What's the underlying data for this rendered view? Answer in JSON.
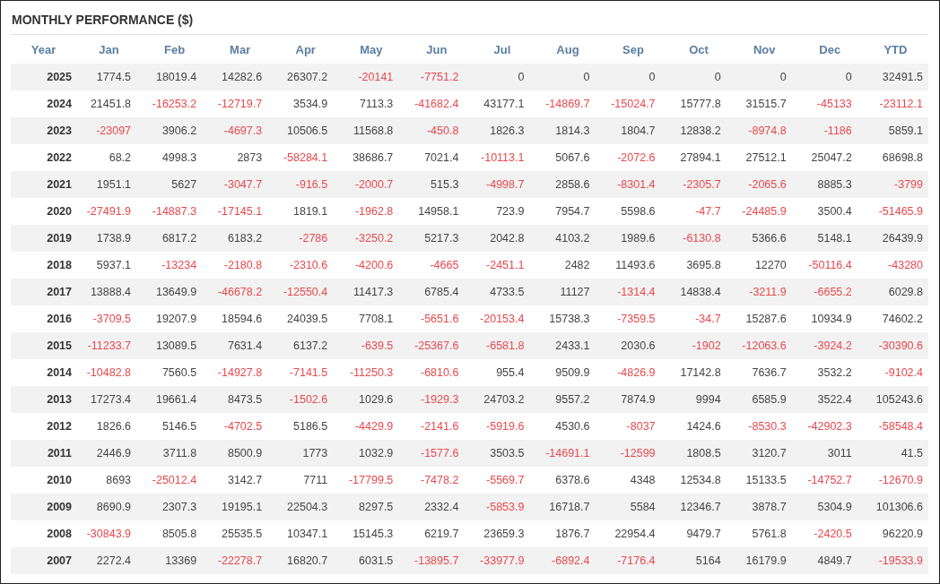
{
  "title": "MONTHLY PERFORMANCE ($)",
  "columns": [
    "Year",
    "Jan",
    "Feb",
    "Mar",
    "Apr",
    "May",
    "Jun",
    "Jul",
    "Aug",
    "Sep",
    "Oct",
    "Nov",
    "Dec",
    "YTD"
  ],
  "rows": [
    {
      "year": "2025",
      "cells": [
        {
          "value": "1774.5",
          "negative": false
        },
        {
          "value": "18019.4",
          "negative": false
        },
        {
          "value": "14282.6",
          "negative": false
        },
        {
          "value": "26307.2",
          "negative": false
        },
        {
          "value": "-20141",
          "negative": true
        },
        {
          "value": "-7751.2",
          "negative": true
        },
        {
          "value": "0",
          "negative": false
        },
        {
          "value": "0",
          "negative": false
        },
        {
          "value": "0",
          "negative": false
        },
        {
          "value": "0",
          "negative": false
        },
        {
          "value": "0",
          "negative": false
        },
        {
          "value": "0",
          "negative": false
        },
        {
          "value": "32491.5",
          "negative": false
        }
      ]
    },
    {
      "year": "2024",
      "cells": [
        {
          "value": "21451.8",
          "negative": false
        },
        {
          "value": "-16253.2",
          "negative": true
        },
        {
          "value": "-12719.7",
          "negative": true
        },
        {
          "value": "3534.9",
          "negative": false
        },
        {
          "value": "7113.3",
          "negative": false
        },
        {
          "value": "-41682.4",
          "negative": true
        },
        {
          "value": "43177.1",
          "negative": false
        },
        {
          "value": "-14869.7",
          "negative": true
        },
        {
          "value": "-15024.7",
          "negative": true
        },
        {
          "value": "15777.8",
          "negative": false
        },
        {
          "value": "31515.7",
          "negative": false
        },
        {
          "value": "-45133",
          "negative": true
        },
        {
          "value": "-23112.1",
          "negative": true
        }
      ]
    },
    {
      "year": "2023",
      "cells": [
        {
          "value": "-23097",
          "negative": true
        },
        {
          "value": "3906.2",
          "negative": false
        },
        {
          "value": "-4697.3",
          "negative": true
        },
        {
          "value": "10506.5",
          "negative": false
        },
        {
          "value": "11568.8",
          "negative": false
        },
        {
          "value": "-450.8",
          "negative": true
        },
        {
          "value": "1826.3",
          "negative": false
        },
        {
          "value": "1814.3",
          "negative": false
        },
        {
          "value": "1804.7",
          "negative": false
        },
        {
          "value": "12838.2",
          "negative": false
        },
        {
          "value": "-8974.8",
          "negative": true
        },
        {
          "value": "-1186",
          "negative": true
        },
        {
          "value": "5859.1",
          "negative": false
        }
      ]
    },
    {
      "year": "2022",
      "cells": [
        {
          "value": "68.2",
          "negative": false
        },
        {
          "value": "4998.3",
          "negative": false
        },
        {
          "value": "2873",
          "negative": false
        },
        {
          "value": "-58284.1",
          "negative": true
        },
        {
          "value": "38686.7",
          "negative": false
        },
        {
          "value": "7021.4",
          "negative": false
        },
        {
          "value": "-10113.1",
          "negative": true
        },
        {
          "value": "5067.6",
          "negative": false
        },
        {
          "value": "-2072.6",
          "negative": true
        },
        {
          "value": "27894.1",
          "negative": false
        },
        {
          "value": "27512.1",
          "negative": false
        },
        {
          "value": "25047.2",
          "negative": false
        },
        {
          "value": "68698.8",
          "negative": false
        }
      ]
    },
    {
      "year": "2021",
      "cells": [
        {
          "value": "1951.1",
          "negative": false
        },
        {
          "value": "5627",
          "negative": false
        },
        {
          "value": "-3047.7",
          "negative": true
        },
        {
          "value": "-916.5",
          "negative": true
        },
        {
          "value": "-2000.7",
          "negative": true
        },
        {
          "value": "515.3",
          "negative": false
        },
        {
          "value": "-4998.7",
          "negative": true
        },
        {
          "value": "2858.6",
          "negative": false
        },
        {
          "value": "-8301.4",
          "negative": true
        },
        {
          "value": "-2305.7",
          "negative": true
        },
        {
          "value": "-2065.6",
          "negative": true
        },
        {
          "value": "8885.3",
          "negative": false
        },
        {
          "value": "-3799",
          "negative": true
        }
      ]
    },
    {
      "year": "2020",
      "cells": [
        {
          "value": "-27491.9",
          "negative": true
        },
        {
          "value": "-14887.3",
          "negative": true
        },
        {
          "value": "-17145.1",
          "negative": true
        },
        {
          "value": "1819.1",
          "negative": false
        },
        {
          "value": "-1962.8",
          "negative": true
        },
        {
          "value": "14958.1",
          "negative": false
        },
        {
          "value": "723.9",
          "negative": false
        },
        {
          "value": "7954.7",
          "negative": false
        },
        {
          "value": "5598.6",
          "negative": false
        },
        {
          "value": "-47.7",
          "negative": true
        },
        {
          "value": "-24485.9",
          "negative": true
        },
        {
          "value": "3500.4",
          "negative": false
        },
        {
          "value": "-51465.9",
          "negative": true
        }
      ]
    },
    {
      "year": "2019",
      "cells": [
        {
          "value": "1738.9",
          "negative": false
        },
        {
          "value": "6817.2",
          "negative": false
        },
        {
          "value": "6183.2",
          "negative": false
        },
        {
          "value": "-2786",
          "negative": true
        },
        {
          "value": "-3250.2",
          "negative": true
        },
        {
          "value": "5217.3",
          "negative": false
        },
        {
          "value": "2042.8",
          "negative": false
        },
        {
          "value": "4103.2",
          "negative": false
        },
        {
          "value": "1989.6",
          "negative": false
        },
        {
          "value": "-6130.8",
          "negative": true
        },
        {
          "value": "5366.6",
          "negative": false
        },
        {
          "value": "5148.1",
          "negative": false
        },
        {
          "value": "26439.9",
          "negative": false
        }
      ]
    },
    {
      "year": "2018",
      "cells": [
        {
          "value": "5937.1",
          "negative": false
        },
        {
          "value": "-13234",
          "negative": true
        },
        {
          "value": "-2180.8",
          "negative": true
        },
        {
          "value": "-2310.6",
          "negative": true
        },
        {
          "value": "-4200.6",
          "negative": true
        },
        {
          "value": "-4665",
          "negative": true
        },
        {
          "value": "-2451.1",
          "negative": true
        },
        {
          "value": "2482",
          "negative": false
        },
        {
          "value": "11493.6",
          "negative": false
        },
        {
          "value": "3695.8",
          "negative": false
        },
        {
          "value": "12270",
          "negative": false
        },
        {
          "value": "-50116.4",
          "negative": true
        },
        {
          "value": "-43280",
          "negative": true
        }
      ]
    },
    {
      "year": "2017",
      "cells": [
        {
          "value": "13888.4",
          "negative": false
        },
        {
          "value": "13649.9",
          "negative": false
        },
        {
          "value": "-46678.2",
          "negative": true
        },
        {
          "value": "-12550.4",
          "negative": true
        },
        {
          "value": "11417.3",
          "negative": false
        },
        {
          "value": "6785.4",
          "negative": false
        },
        {
          "value": "4733.5",
          "negative": false
        },
        {
          "value": "11127",
          "negative": false
        },
        {
          "value": "-1314.4",
          "negative": true
        },
        {
          "value": "14838.4",
          "negative": false
        },
        {
          "value": "-3211.9",
          "negative": true
        },
        {
          "value": "-6655.2",
          "negative": true
        },
        {
          "value": "6029.8",
          "negative": false
        }
      ]
    },
    {
      "year": "2016",
      "cells": [
        {
          "value": "-3709.5",
          "negative": true
        },
        {
          "value": "19207.9",
          "negative": false
        },
        {
          "value": "18594.6",
          "negative": false
        },
        {
          "value": "24039.5",
          "negative": false
        },
        {
          "value": "7708.1",
          "negative": false
        },
        {
          "value": "-5651.6",
          "negative": true
        },
        {
          "value": "-20153.4",
          "negative": true
        },
        {
          "value": "15738.3",
          "negative": false
        },
        {
          "value": "-7359.5",
          "negative": true
        },
        {
          "value": "-34.7",
          "negative": true
        },
        {
          "value": "15287.6",
          "negative": false
        },
        {
          "value": "10934.9",
          "negative": false
        },
        {
          "value": "74602.2",
          "negative": false
        }
      ]
    },
    {
      "year": "2015",
      "cells": [
        {
          "value": "-11233.7",
          "negative": true
        },
        {
          "value": "13089.5",
          "negative": false
        },
        {
          "value": "7631.4",
          "negative": false
        },
        {
          "value": "6137.2",
          "negative": false
        },
        {
          "value": "-639.5",
          "negative": true
        },
        {
          "value": "-25367.6",
          "negative": true
        },
        {
          "value": "-6581.8",
          "negative": true
        },
        {
          "value": "2433.1",
          "negative": false
        },
        {
          "value": "2030.6",
          "negative": false
        },
        {
          "value": "-1902",
          "negative": true
        },
        {
          "value": "-12063.6",
          "negative": true
        },
        {
          "value": "-3924.2",
          "negative": true
        },
        {
          "value": "-30390.6",
          "negative": true
        }
      ]
    },
    {
      "year": "2014",
      "cells": [
        {
          "value": "-10482.8",
          "negative": true
        },
        {
          "value": "7560.5",
          "negative": false
        },
        {
          "value": "-14927.8",
          "negative": true
        },
        {
          "value": "-7141.5",
          "negative": true
        },
        {
          "value": "-11250.3",
          "negative": true
        },
        {
          "value": "-6810.6",
          "negative": true
        },
        {
          "value": "955.4",
          "negative": false
        },
        {
          "value": "9509.9",
          "negative": false
        },
        {
          "value": "-4826.9",
          "negative": true
        },
        {
          "value": "17142.8",
          "negative": false
        },
        {
          "value": "7636.7",
          "negative": false
        },
        {
          "value": "3532.2",
          "negative": false
        },
        {
          "value": "-9102.4",
          "negative": true
        }
      ]
    },
    {
      "year": "2013",
      "cells": [
        {
          "value": "17273.4",
          "negative": false
        },
        {
          "value": "19661.4",
          "negative": false
        },
        {
          "value": "8473.5",
          "negative": false
        },
        {
          "value": "-1502.6",
          "negative": true
        },
        {
          "value": "1029.6",
          "negative": false
        },
        {
          "value": "-1929.3",
          "negative": true
        },
        {
          "value": "24703.2",
          "negative": false
        },
        {
          "value": "9557.2",
          "negative": false
        },
        {
          "value": "7874.9",
          "negative": false
        },
        {
          "value": "9994",
          "negative": false
        },
        {
          "value": "6585.9",
          "negative": false
        },
        {
          "value": "3522.4",
          "negative": false
        },
        {
          "value": "105243.6",
          "negative": false
        }
      ]
    },
    {
      "year": "2012",
      "cells": [
        {
          "value": "1826.6",
          "negative": false
        },
        {
          "value": "5146.5",
          "negative": false
        },
        {
          "value": "-4702.5",
          "negative": true
        },
        {
          "value": "5186.5",
          "negative": false
        },
        {
          "value": "-4429.9",
          "negative": true
        },
        {
          "value": "-2141.6",
          "negative": true
        },
        {
          "value": "-5919.6",
          "negative": true
        },
        {
          "value": "4530.6",
          "negative": false
        },
        {
          "value": "-8037",
          "negative": true
        },
        {
          "value": "1424.6",
          "negative": false
        },
        {
          "value": "-8530.3",
          "negative": true
        },
        {
          "value": "-42902.3",
          "negative": true
        },
        {
          "value": "-58548.4",
          "negative": true
        }
      ]
    },
    {
      "year": "2011",
      "cells": [
        {
          "value": "2446.9",
          "negative": false
        },
        {
          "value": "3711.8",
          "negative": false
        },
        {
          "value": "8500.9",
          "negative": false
        },
        {
          "value": "1773",
          "negative": false
        },
        {
          "value": "1032.9",
          "negative": false
        },
        {
          "value": "-1577.6",
          "negative": true
        },
        {
          "value": "3503.5",
          "negative": false
        },
        {
          "value": "-14691.1",
          "negative": true
        },
        {
          "value": "-12599",
          "negative": true
        },
        {
          "value": "1808.5",
          "negative": false
        },
        {
          "value": "3120.7",
          "negative": false
        },
        {
          "value": "3011",
          "negative": false
        },
        {
          "value": "41.5",
          "negative": false
        }
      ]
    },
    {
      "year": "2010",
      "cells": [
        {
          "value": "8693",
          "negative": false
        },
        {
          "value": "-25012.4",
          "negative": true
        },
        {
          "value": "3142.7",
          "negative": false
        },
        {
          "value": "7711",
          "negative": false
        },
        {
          "value": "-17799.5",
          "negative": true
        },
        {
          "value": "-7478.2",
          "negative": true
        },
        {
          "value": "-5569.7",
          "negative": true
        },
        {
          "value": "6378.6",
          "negative": false
        },
        {
          "value": "4348",
          "negative": false
        },
        {
          "value": "12534.8",
          "negative": false
        },
        {
          "value": "15133.5",
          "negative": false
        },
        {
          "value": "-14752.7",
          "negative": true
        },
        {
          "value": "-12670.9",
          "negative": true
        }
      ]
    },
    {
      "year": "2009",
      "cells": [
        {
          "value": "8690.9",
          "negative": false
        },
        {
          "value": "2307.3",
          "negative": false
        },
        {
          "value": "19195.1",
          "negative": false
        },
        {
          "value": "22504.3",
          "negative": false
        },
        {
          "value": "8297.5",
          "negative": false
        },
        {
          "value": "2332.4",
          "negative": false
        },
        {
          "value": "-5853.9",
          "negative": true
        },
        {
          "value": "16718.7",
          "negative": false
        },
        {
          "value": "5584",
          "negative": false
        },
        {
          "value": "12346.7",
          "negative": false
        },
        {
          "value": "3878.7",
          "negative": false
        },
        {
          "value": "5304.9",
          "negative": false
        },
        {
          "value": "101306.6",
          "negative": false
        }
      ]
    },
    {
      "year": "2008",
      "cells": [
        {
          "value": "-30843.9",
          "negative": true
        },
        {
          "value": "8505.8",
          "negative": false
        },
        {
          "value": "25535.5",
          "negative": false
        },
        {
          "value": "10347.1",
          "negative": false
        },
        {
          "value": "15145.3",
          "negative": false
        },
        {
          "value": "6219.7",
          "negative": false
        },
        {
          "value": "23659.3",
          "negative": false
        },
        {
          "value": "1876.7",
          "negative": false
        },
        {
          "value": "22954.4",
          "negative": false
        },
        {
          "value": "9479.7",
          "negative": false
        },
        {
          "value": "5761.8",
          "negative": false
        },
        {
          "value": "-2420.5",
          "negative": true
        },
        {
          "value": "96220.9",
          "negative": false
        }
      ]
    },
    {
      "year": "2007",
      "cells": [
        {
          "value": "2272.4",
          "negative": false
        },
        {
          "value": "13369",
          "negative": false
        },
        {
          "value": "-22278.7",
          "negative": true
        },
        {
          "value": "16820.7",
          "negative": false
        },
        {
          "value": "6031.5",
          "negative": false
        },
        {
          "value": "-13895.7",
          "negative": true
        },
        {
          "value": "-33977.9",
          "negative": true
        },
        {
          "value": "-6892.4",
          "negative": true
        },
        {
          "value": "-7176.4",
          "negative": true
        },
        {
          "value": "5164",
          "negative": false
        },
        {
          "value": "16179.9",
          "negative": false
        },
        {
          "value": "4849.7",
          "negative": false
        },
        {
          "value": "-19533.9",
          "negative": true
        }
      ]
    }
  ]
}
